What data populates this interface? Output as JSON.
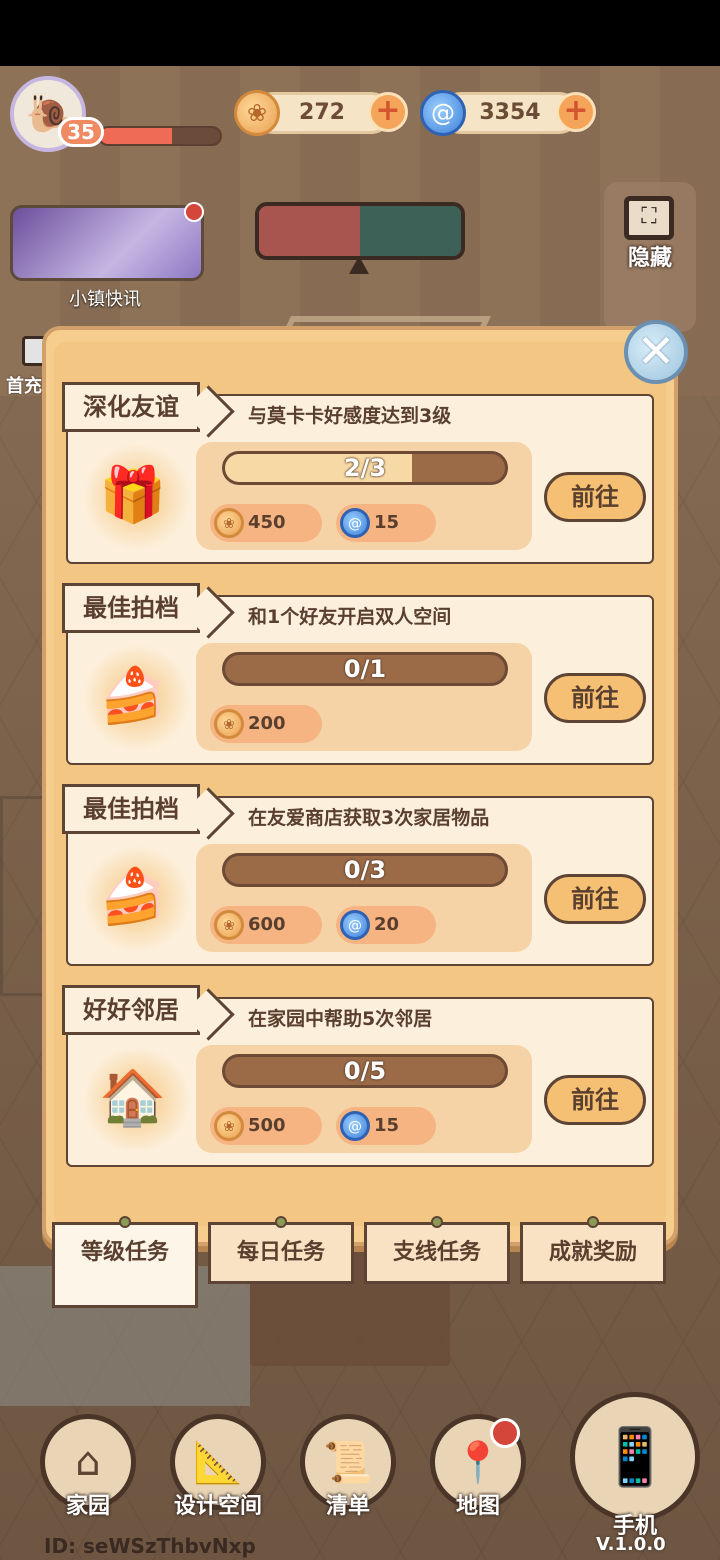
{
  "hud": {
    "level": "35",
    "xp_fraction": 0.6,
    "coins": "272",
    "gems": "3354",
    "avatar_icon": "snail-icon"
  },
  "news": {
    "label": "小镇快讯"
  },
  "hide": {
    "label": "隐藏"
  },
  "side": {
    "label": "首充"
  },
  "close_icon": "✕",
  "tasks": [
    {
      "title": "深化友谊",
      "desc": "与莫卡卡好感度达到3级",
      "icon": "gift-icon",
      "progress": "2/3",
      "progress_fraction": 0.667,
      "coin_reward": "450",
      "gem_reward": "15",
      "go": "前往"
    },
    {
      "title": "最佳拍档",
      "desc": "和1个好友开启双人空间",
      "icon": "cake-icon",
      "progress": "0/1",
      "progress_fraction": 0,
      "coin_reward": "200",
      "go": "前往"
    },
    {
      "title": "最佳拍档",
      "desc": "在友爱商店获取3次家居物品",
      "icon": "cake-icon",
      "progress": "0/3",
      "progress_fraction": 0,
      "coin_reward": "600",
      "gem_reward": "20",
      "go": "前往"
    },
    {
      "title": "好好邻居",
      "desc": "在家园中帮助5次邻居",
      "icon": "house-icon",
      "progress": "0/5",
      "progress_fraction": 0,
      "coin_reward": "500",
      "gem_reward": "15",
      "go": "前往"
    }
  ],
  "tabs": [
    "等级任务",
    "每日任务",
    "支线任务",
    "成就奖励"
  ],
  "nav": {
    "home": "家园",
    "design": "设计空间",
    "list": "清单",
    "map": "地图",
    "phone": "手机"
  },
  "footer": {
    "user_id": "ID:  seWSzThbvNxp",
    "version": "V.1.0.0"
  }
}
